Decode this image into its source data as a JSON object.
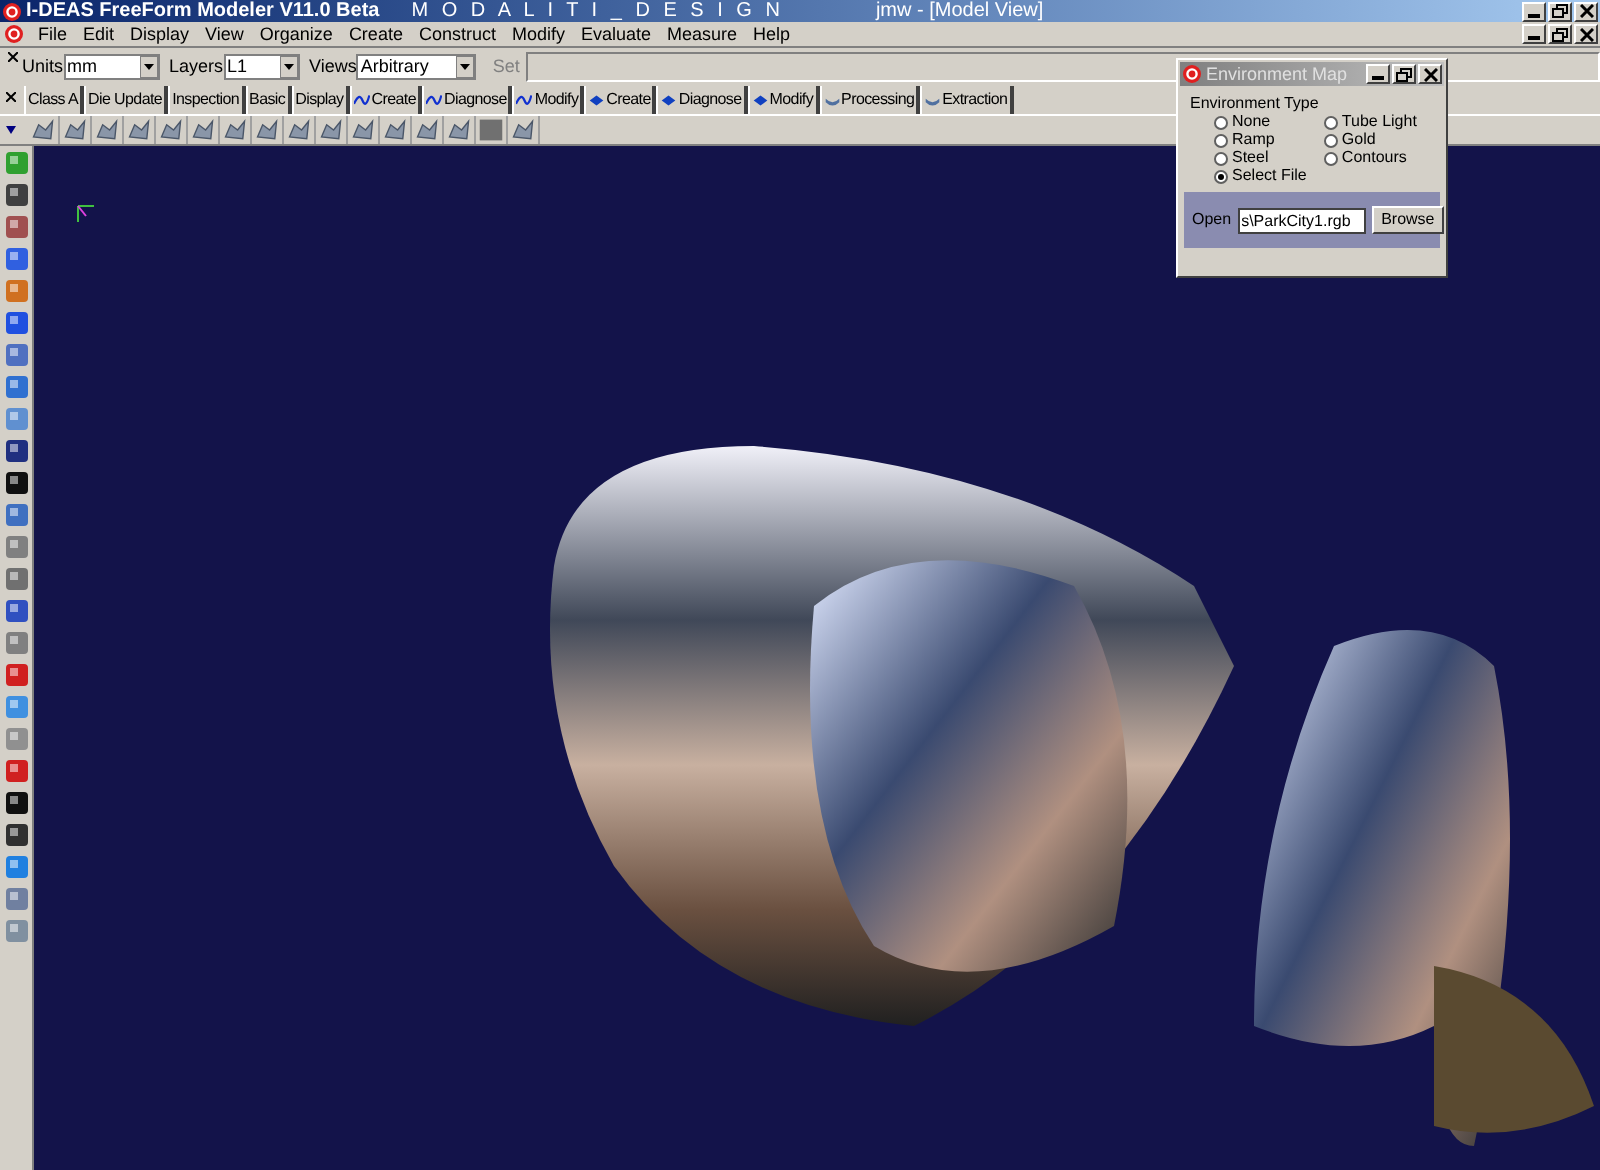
{
  "window": {
    "title": "I-DEAS FreeForm Modeler V11.0 Beta",
    "brand": "M O D A L I T I  _  D E S I G N",
    "document": "jmw - [Model View]"
  },
  "menu": [
    "File",
    "Edit",
    "Display",
    "View",
    "Organize",
    "Create",
    "Construct",
    "Modify",
    "Evaluate",
    "Measure",
    "Help"
  ],
  "options_bar": [
    {
      "label": "Units",
      "value": "mm"
    },
    {
      "label": "Layers",
      "value": "L1"
    },
    {
      "label": "Views",
      "value": "Arbitrary"
    }
  ],
  "set_label": "Set",
  "tabs": [
    {
      "label": "Class A",
      "kind": "plain"
    },
    {
      "label": "Die Update",
      "kind": "plain"
    },
    {
      "label": "Inspection",
      "kind": "plain"
    },
    {
      "label": "Basic",
      "kind": "plain"
    },
    {
      "label": "Display",
      "kind": "plain"
    },
    {
      "label": "Create",
      "kind": "curve"
    },
    {
      "label": "Diagnose",
      "kind": "curve"
    },
    {
      "label": "Modify",
      "kind": "curve"
    },
    {
      "label": "Create",
      "kind": "surface"
    },
    {
      "label": "Diagnose",
      "kind": "surface"
    },
    {
      "label": "Modify",
      "kind": "surface"
    },
    {
      "label": "Processing",
      "kind": "shell"
    },
    {
      "label": "Extraction",
      "kind": "shell"
    }
  ],
  "dialog": {
    "title": "Environment Map",
    "group_label": "Environment Type",
    "options": [
      {
        "label": "None",
        "selected": false
      },
      {
        "label": "Ramp",
        "selected": false
      },
      {
        "label": "Steel",
        "selected": false
      },
      {
        "label": "Select File",
        "selected": true
      },
      {
        "label": "Tube Light",
        "selected": false
      },
      {
        "label": "Gold",
        "selected": false
      },
      {
        "label": "Contours",
        "selected": false
      }
    ],
    "open_label": "Open",
    "file_value": "s\\ParkCity1.rgb",
    "browse_button": "Browse"
  }
}
